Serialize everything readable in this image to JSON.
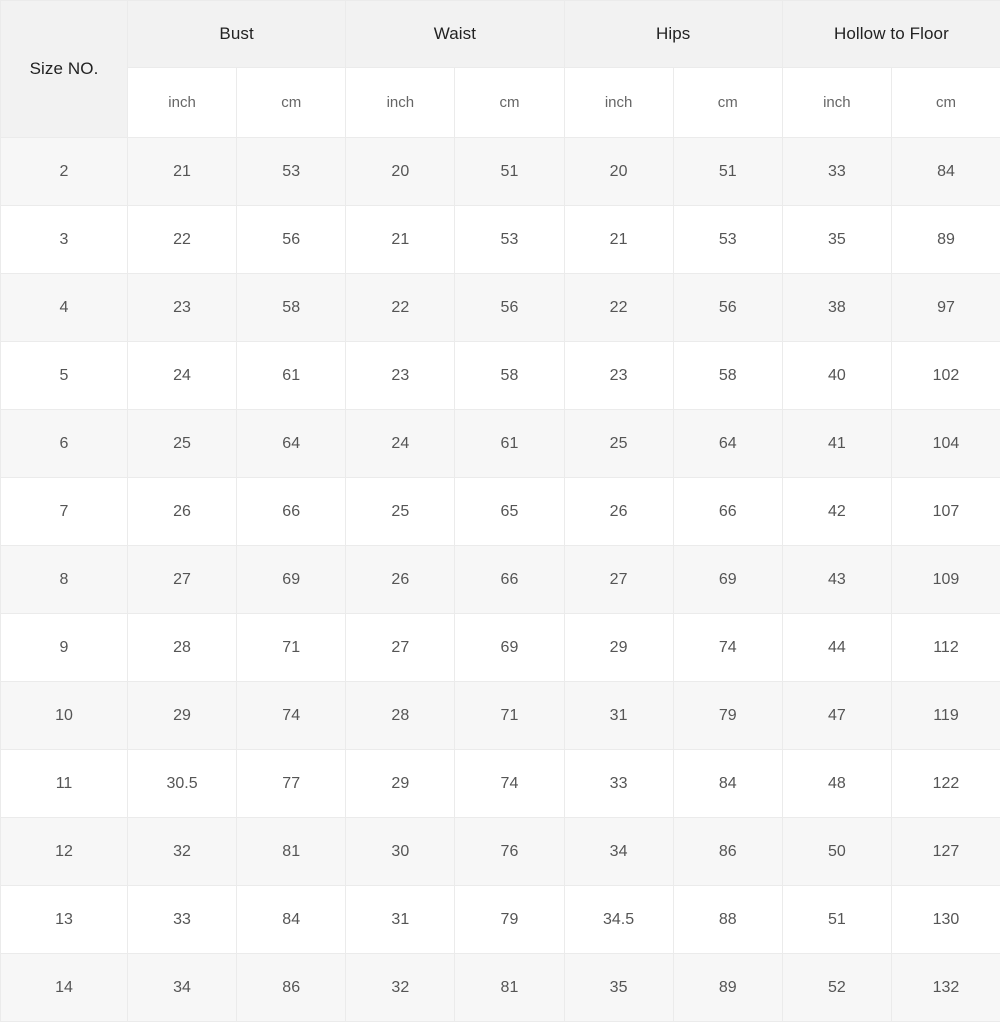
{
  "table": {
    "groups": [
      {
        "label": "Size NO.",
        "span": 1
      },
      {
        "label": "Bust",
        "span": 2
      },
      {
        "label": "Waist",
        "span": 2
      },
      {
        "label": "Hips",
        "span": 2
      },
      {
        "label": "Hollow to Floor",
        "span": 2
      }
    ],
    "units": [
      "",
      "inch",
      "cm",
      "inch",
      "cm",
      "inch",
      "cm",
      "inch",
      "cm"
    ],
    "columns": [
      "Size NO.",
      "Bust inch",
      "Bust cm",
      "Waist inch",
      "Waist cm",
      "Hips inch",
      "Hips cm",
      "Hollow to Floor inch",
      "Hollow to Floor cm"
    ],
    "rows": [
      [
        "2",
        "21",
        "53",
        "20",
        "51",
        "20",
        "51",
        "33",
        "84"
      ],
      [
        "3",
        "22",
        "56",
        "21",
        "53",
        "21",
        "53",
        "35",
        "89"
      ],
      [
        "4",
        "23",
        "58",
        "22",
        "56",
        "22",
        "56",
        "38",
        "97"
      ],
      [
        "5",
        "24",
        "61",
        "23",
        "58",
        "23",
        "58",
        "40",
        "102"
      ],
      [
        "6",
        "25",
        "64",
        "24",
        "61",
        "25",
        "64",
        "41",
        "104"
      ],
      [
        "7",
        "26",
        "66",
        "25",
        "65",
        "26",
        "66",
        "42",
        "107"
      ],
      [
        "8",
        "27",
        "69",
        "26",
        "66",
        "27",
        "69",
        "43",
        "109"
      ],
      [
        "9",
        "28",
        "71",
        "27",
        "69",
        "29",
        "74",
        "44",
        "112"
      ],
      [
        "10",
        "29",
        "74",
        "28",
        "71",
        "31",
        "79",
        "47",
        "119"
      ],
      [
        "11",
        "30.5",
        "77",
        "29",
        "74",
        "33",
        "84",
        "48",
        "122"
      ],
      [
        "12",
        "32",
        "81",
        "30",
        "76",
        "34",
        "86",
        "50",
        "127"
      ],
      [
        "13",
        "33",
        "84",
        "31",
        "79",
        "34.5",
        "88",
        "51",
        "130"
      ],
      [
        "14",
        "34",
        "86",
        "32",
        "81",
        "35",
        "89",
        "52",
        "132"
      ]
    ]
  },
  "colors": {
    "header_background": "#f2f2f2",
    "row_alt_background": "#f7f7f7",
    "row_background": "#ffffff",
    "border": "#ebebeb",
    "header_text": "#222222",
    "unit_text": "#666666",
    "cell_text": "#555555"
  }
}
